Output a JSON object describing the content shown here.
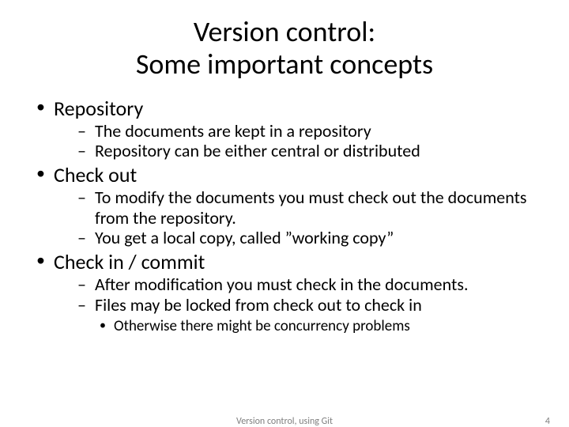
{
  "title_line1": "Version control:",
  "title_line2": "Some important concepts",
  "bullets": [
    {
      "label": "Repository",
      "sub": [
        "The documents are kept in a repository",
        "Repository can be either central or distributed"
      ]
    },
    {
      "label": "Check out",
      "sub": [
        "To modify the documents you must check out the documents from the repository.",
        "You get a local copy, called ”working copy”"
      ]
    },
    {
      "label": "Check in / commit",
      "sub": [
        "After modification you must check in the documents.",
        "Files may be locked from check out to check in"
      ],
      "subsub": [
        "Otherwise there might be concurrency problems"
      ]
    }
  ],
  "footer": {
    "center": "Version control, using Git",
    "page": "4"
  }
}
